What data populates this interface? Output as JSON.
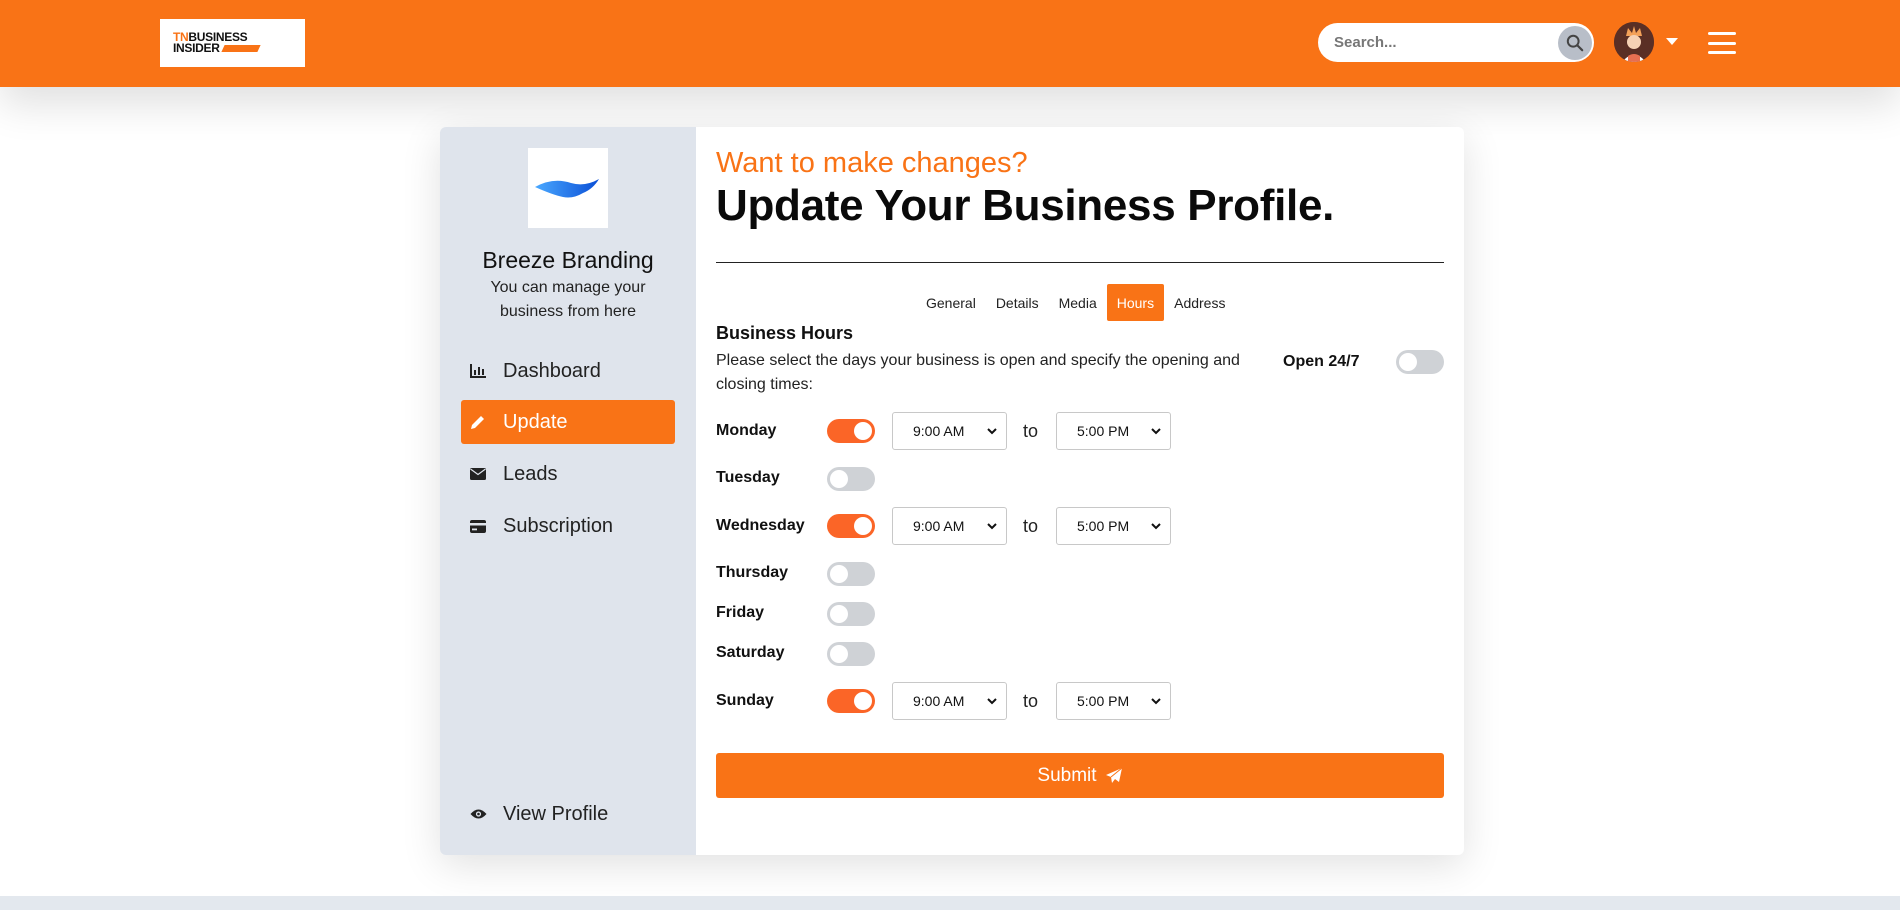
{
  "header": {
    "logo": {
      "line1_a": "TN",
      "line1_b": "BUSINESS",
      "line2": "INSIDER"
    },
    "search": {
      "placeholder": "Search...",
      "value": ""
    },
    "colors": {
      "accent": "#f97316"
    }
  },
  "sidebar": {
    "business_name": "Breeze Branding",
    "subtitle": "You can manage your business from here",
    "items": [
      {
        "label": "Dashboard",
        "icon": "chart-icon",
        "active": false
      },
      {
        "label": "Update",
        "icon": "pencil-icon",
        "active": true
      },
      {
        "label": "Leads",
        "icon": "envelope-icon",
        "active": false
      },
      {
        "label": "Subscription",
        "icon": "credit-card-icon",
        "active": false
      }
    ],
    "view_profile": {
      "label": "View Profile",
      "icon": "eye-icon"
    }
  },
  "main": {
    "kicker": "Want to make changes?",
    "title": "Update Your Business Profile.",
    "tabs": [
      {
        "label": "General",
        "active": false
      },
      {
        "label": "Details",
        "active": false
      },
      {
        "label": "Media",
        "active": false
      },
      {
        "label": "Hours",
        "active": true
      },
      {
        "label": "Address",
        "active": false
      }
    ],
    "section_title": "Business Hours",
    "section_desc": "Please select the days your business is open and specify the opening and closing times:",
    "open247": {
      "label": "Open 24/7",
      "enabled": false
    },
    "to_label": "to",
    "days": [
      {
        "name": "Monday",
        "open": true,
        "from": "9:00 AM",
        "to": "5:00 PM"
      },
      {
        "name": "Tuesday",
        "open": false
      },
      {
        "name": "Wednesday",
        "open": true,
        "from": "9:00 AM",
        "to": "5:00 PM"
      },
      {
        "name": "Thursday",
        "open": false
      },
      {
        "name": "Friday",
        "open": false
      },
      {
        "name": "Saturday",
        "open": false
      },
      {
        "name": "Sunday",
        "open": true,
        "from": "9:00 AM",
        "to": "5:00 PM"
      }
    ],
    "submit_label": "Submit"
  }
}
